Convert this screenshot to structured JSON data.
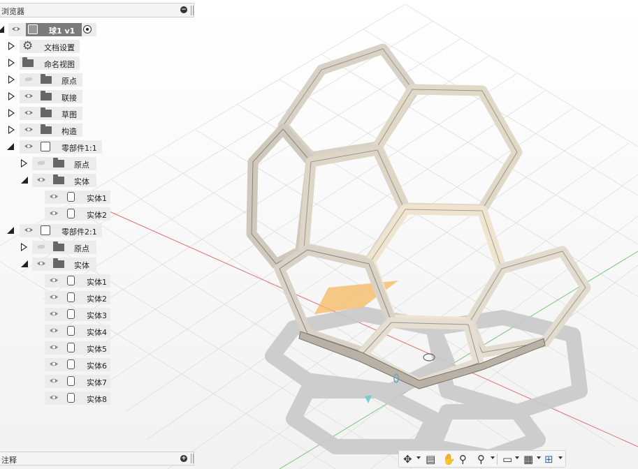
{
  "browser": {
    "title": "浏览器",
    "root": {
      "label": "球1 v1"
    },
    "items": [
      {
        "label": "文档设置"
      },
      {
        "label": "命名视图"
      },
      {
        "label": "原点"
      },
      {
        "label": "联接"
      },
      {
        "label": "草图"
      },
      {
        "label": "构造"
      },
      {
        "label": "零部件1:1"
      },
      {
        "label": "原点"
      },
      {
        "label": "实体"
      },
      {
        "label": "实体1"
      },
      {
        "label": "实体2"
      },
      {
        "label": "零部件2:1"
      },
      {
        "label": "原点"
      },
      {
        "label": "实体"
      },
      {
        "label": "实体1"
      },
      {
        "label": "实体2"
      },
      {
        "label": "实体3"
      },
      {
        "label": "实体4"
      },
      {
        "label": "实体5"
      },
      {
        "label": "实体6"
      },
      {
        "label": "实体7"
      },
      {
        "label": "实体8"
      }
    ]
  },
  "notes": {
    "title": "注释"
  },
  "toolbar": {
    "tools": [
      "orbit-icon",
      "look-at-icon",
      "pan-icon",
      "zoom-icon",
      "fit-icon",
      "display-settings-icon",
      "grid-icon",
      "viewports-icon"
    ]
  },
  "colors": {
    "frame_light": "#d8d2c6",
    "frame_dark": "#8a857c",
    "shadow": "#c9c9c9",
    "x_axis": "#e07070",
    "y_axis": "#7ac47a",
    "origin_plane": "#f6b860"
  }
}
